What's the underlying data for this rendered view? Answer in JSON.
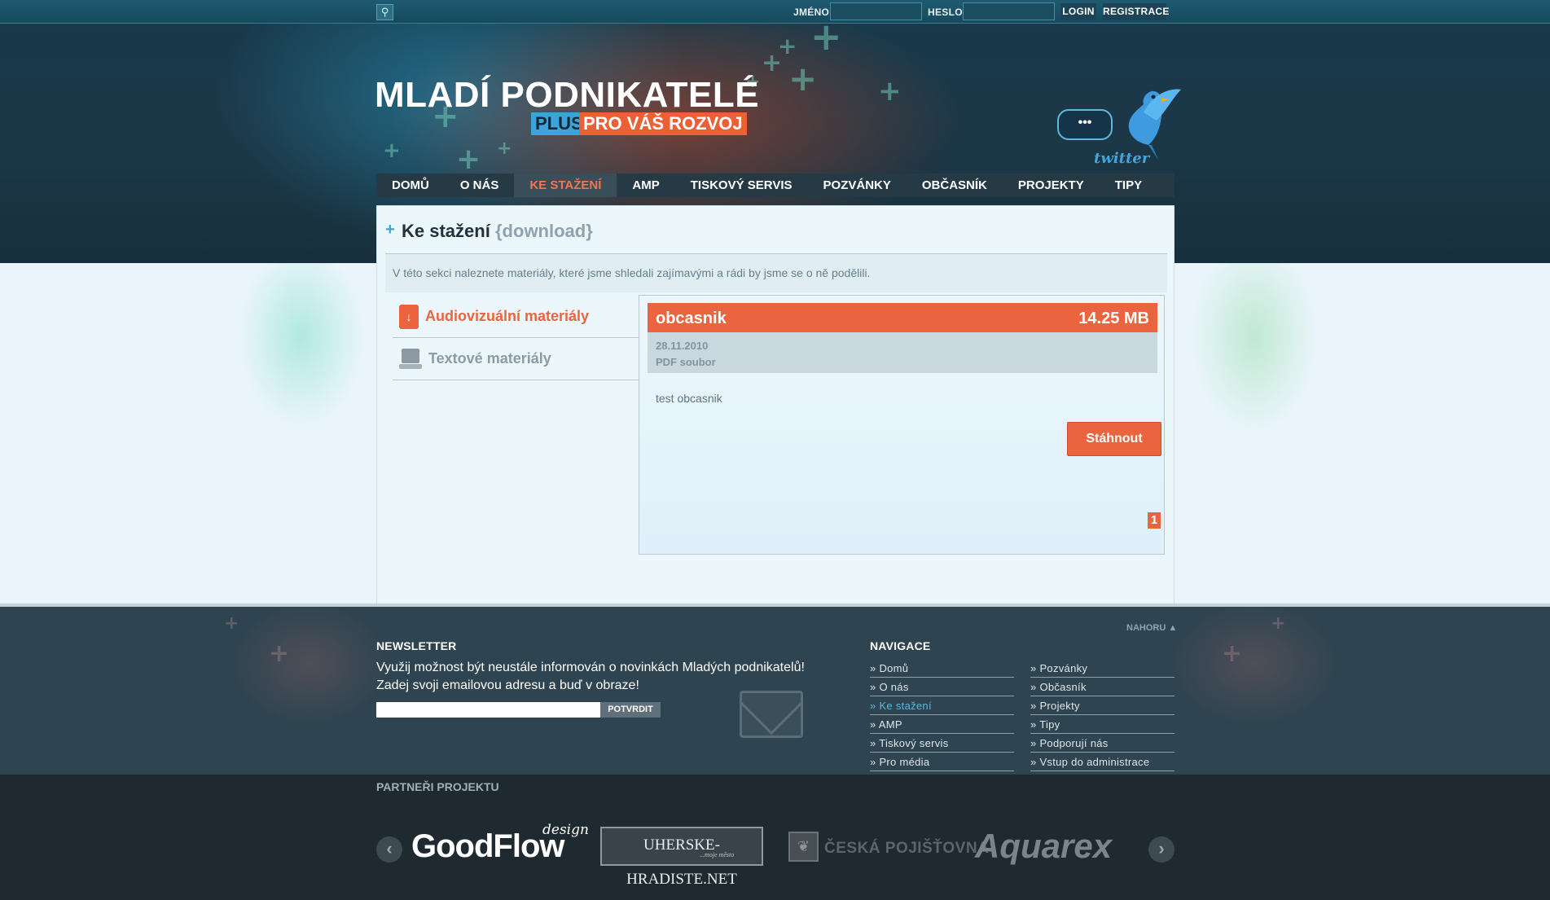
{
  "topbar": {
    "search_icon": "magnifier-icon",
    "name_label": "JMÉNO",
    "name_value": "",
    "password_label": "HESLO",
    "password_value": "",
    "login_label": "LOGIN",
    "register_label": "REGISTRACE"
  },
  "logo": {
    "title": "MLADÍ PODNIKATELÉ",
    "plus": "PLUS",
    "tagline": "PRO VÁŠ ROZVOJ"
  },
  "twitter": {
    "bubble": "•••",
    "label": "twitter",
    "icon": "twitter-bird-icon"
  },
  "nav": {
    "items": [
      "DOMŮ",
      "O NÁS",
      "KE STAŽENÍ",
      "AMP",
      "TISKOVÝ SERVIS",
      "POZVÁNKY",
      "OBČASNÍK",
      "PROJEKTY",
      "TIPY"
    ],
    "active": "KE STAŽENÍ"
  },
  "page": {
    "title": "Ke stažení",
    "subtitle": "{download}",
    "intro": "V této sekci naleznete materiály, které jsme shledali zajímavými a rádi by jsme se o ně podělili."
  },
  "categories": {
    "items": [
      {
        "label": "Audiovizuální materiály",
        "icon": "document-download-icon",
        "active": true
      },
      {
        "label": "Textové materiály",
        "icon": "laptop-icon",
        "active": false
      }
    ]
  },
  "download": {
    "name": "obcasnik",
    "size": "14.25 MB",
    "date": "28.11.2010",
    "type": "PDF soubor",
    "description": "test obcasnik",
    "button": "Stáhnout",
    "page": "1"
  },
  "footer": {
    "to_top": "NAHORU ▲",
    "newsletter_heading": "NEWSLETTER",
    "newsletter_text_1": "Využij možnost být neustále informován o novinkách Mladých podnikatelů!",
    "newsletter_text_2": "Zadej svoji emailovou adresu a buď v obraze!",
    "newsletter_placeholder": "",
    "newsletter_button": "POTVRDIT",
    "navigation_heading": "NAVIGACE",
    "nav_left": [
      "» Domů",
      "» O nás",
      "» Ke stažení",
      "» AMP",
      "» Tiskový servis",
      "» Pro média"
    ],
    "nav_right": [
      "» Pozvánky",
      "» Občasník",
      "» Projekty",
      "» Tipy",
      "» Podporují nás",
      "» Vstup do administrace"
    ],
    "nav_active": "» Ke stažení"
  },
  "partners": {
    "heading": "PARTNEŘI PROJEKTU",
    "prev_icon": "chevron-left-icon",
    "next_icon": "chevron-right-icon",
    "logos": [
      "GoodFlow design",
      "Uherske-Hradiste.net ...moje město",
      "Česká pojišťovna",
      "Aquarex"
    ]
  },
  "colors": {
    "accent": "#ea6440",
    "brand_blue": "#3ea3d8",
    "header_dark": "#18303d",
    "footer_dark": "#2e4450"
  }
}
